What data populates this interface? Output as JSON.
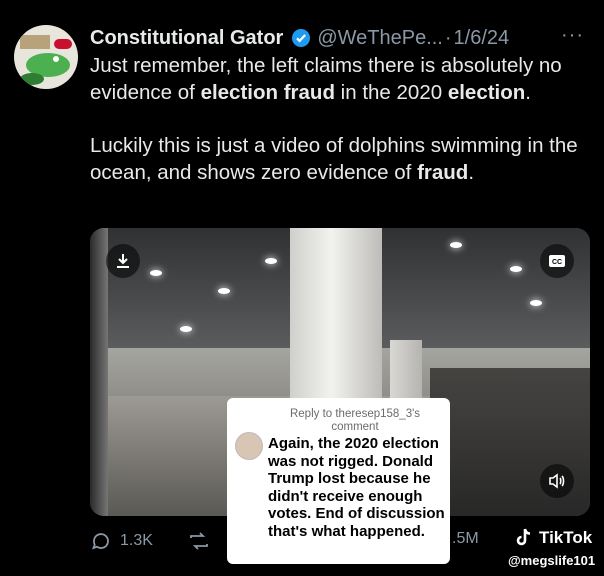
{
  "tweet": {
    "author_name": "Constitutional Gator",
    "handle": "@WeThePe...",
    "separator": "·",
    "date": "1/6/24",
    "more": "···",
    "paragraph1": {
      "t1": "Just remember, the left claims there is absolutely no evidence of ",
      "b1": "election fraud",
      "t2": " in the 2020 ",
      "b2": "election",
      "t3": "."
    },
    "paragraph2": {
      "t1": "Luckily this is just a video of dolphins swimming in the ocean, and shows zero evidence of ",
      "b1": "fraud",
      "t2": "."
    }
  },
  "media": {
    "reply_label": "Reply to theresep158_3's comment",
    "comment": "Again, the 2020 election was not rigged. Donald Trump lost because he didn't receive enough votes. End of discussion that's what happened."
  },
  "actions": {
    "replies": "1.3K",
    "views": ".5M"
  },
  "watermark": {
    "brand": "TikTok",
    "username": "@megslife101"
  },
  "colors": {
    "background": "#000000",
    "text": "#e7e9ea",
    "secondary": "#8b98a5",
    "verified": "#1d9bf0"
  },
  "icons": [
    "download-icon",
    "cc-icon",
    "speaker-icon",
    "reply-icon",
    "retweet-icon",
    "verified-icon",
    "tiktok-logo-icon"
  ]
}
